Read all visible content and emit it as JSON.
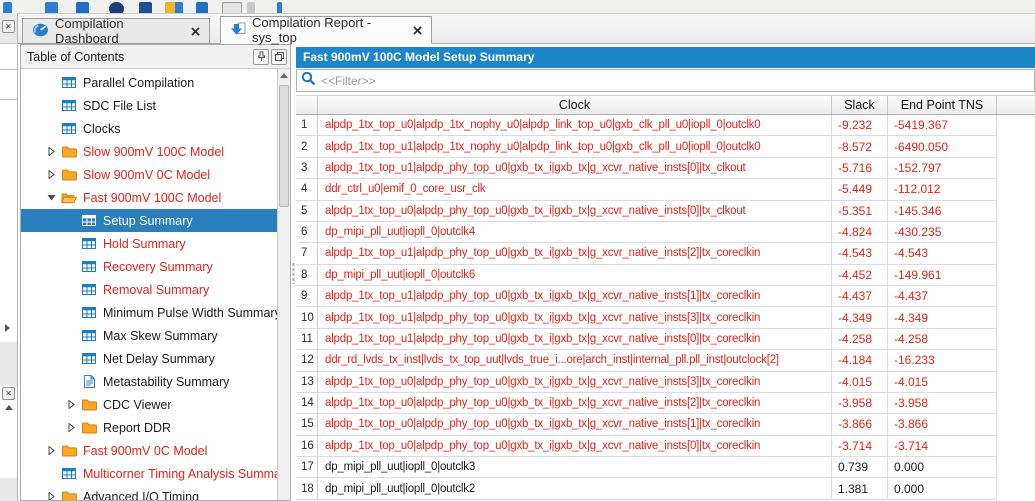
{
  "tabs": [
    {
      "label": "Compilation Dashboard",
      "icon": "gauge-icon",
      "active": false
    },
    {
      "label": "Compilation Report - sys_top",
      "icon": "report-icon",
      "active": true
    }
  ],
  "toc": {
    "title": "Table of Contents",
    "items": [
      {
        "label": "Parallel Compilation",
        "icon": "table",
        "level": 1
      },
      {
        "label": "SDC File List",
        "icon": "table",
        "level": 1
      },
      {
        "label": "Clocks",
        "icon": "table",
        "level": 1
      },
      {
        "label": "Slow 900mV 100C Model",
        "icon": "folder",
        "level": 1,
        "arrow": "collapsed",
        "red": true
      },
      {
        "label": "Slow 900mV 0C Model",
        "icon": "folder",
        "level": 1,
        "arrow": "collapsed",
        "red": true
      },
      {
        "label": "Fast 900mV 100C Model",
        "icon": "folder-open",
        "level": 1,
        "arrow": "expanded",
        "red": true
      },
      {
        "label": "Setup Summary",
        "icon": "table",
        "level": 2,
        "selected": true
      },
      {
        "label": "Hold Summary",
        "icon": "table",
        "level": 2,
        "red": true
      },
      {
        "label": "Recovery Summary",
        "icon": "table",
        "level": 2,
        "red": true
      },
      {
        "label": "Removal Summary",
        "icon": "table",
        "level": 2,
        "red": true
      },
      {
        "label": "Minimum Pulse Width Summary",
        "icon": "table",
        "level": 2
      },
      {
        "label": "Max Skew Summary",
        "icon": "table",
        "level": 2
      },
      {
        "label": "Net Delay Summary",
        "icon": "table",
        "level": 2
      },
      {
        "label": "Metastability Summary",
        "icon": "doc",
        "level": 2
      },
      {
        "label": "CDC Viewer",
        "icon": "folder",
        "level": 2,
        "arrow": "collapsed"
      },
      {
        "label": "Report DDR",
        "icon": "folder",
        "level": 2,
        "arrow": "collapsed"
      },
      {
        "label": "Fast 900mV 0C Model",
        "icon": "folder",
        "level": 1,
        "arrow": "collapsed",
        "red": true
      },
      {
        "label": "Multicorner Timing Analysis Summary",
        "icon": "table",
        "level": 1,
        "red": true
      },
      {
        "label": "Advanced I/O Timing",
        "icon": "folder",
        "level": 1,
        "arrow": "collapsed"
      }
    ]
  },
  "report": {
    "title": "Fast 900mV 100C Model Setup Summary",
    "filter_placeholder": "<<Filter>>",
    "columns": {
      "clock": "Clock",
      "slack": "Slack",
      "tns": "End Point TNS"
    },
    "rows": [
      {
        "num": 1,
        "clock": "alpdp_1tx_top_u0|alpdp_1tx_nophy_u0|alpdp_link_top_u0|gxb_clk_pll_u0|iopll_0|outclk0",
        "slack": "-9.232",
        "tns": "-5419.367",
        "violated": true
      },
      {
        "num": 2,
        "clock": "alpdp_1tx_top_u1|alpdp_1tx_nophy_u0|alpdp_link_top_u0|gxb_clk_pll_u0|iopll_0|outclk0",
        "slack": "-8.572",
        "tns": "-6490.050",
        "violated": true
      },
      {
        "num": 3,
        "clock": "alpdp_1tx_top_u1|alpdp_phy_top_u0|gxb_tx_i|gxb_tx|g_xcvr_native_insts[0]|tx_clkout",
        "slack": "-5.716",
        "tns": "-152.797",
        "violated": true
      },
      {
        "num": 4,
        "clock": "ddr_ctrl_u0|emif_0_core_usr_clk",
        "slack": "-5.449",
        "tns": "-112.012",
        "violated": true
      },
      {
        "num": 5,
        "clock": "alpdp_1tx_top_u0|alpdp_phy_top_u0|gxb_tx_i|gxb_tx|g_xcvr_native_insts[0]|tx_clkout",
        "slack": "-5.351",
        "tns": "-145.346",
        "violated": true
      },
      {
        "num": 6,
        "clock": "dp_mipi_pll_uut|iopll_0|outclk4",
        "slack": "-4.824",
        "tns": "-430.235",
        "violated": true
      },
      {
        "num": 7,
        "clock": "alpdp_1tx_top_u1|alpdp_phy_top_u0|gxb_tx_i|gxb_tx|g_xcvr_native_insts[2]|tx_coreclkin",
        "slack": "-4.543",
        "tns": "-4.543",
        "violated": true
      },
      {
        "num": 8,
        "clock": "dp_mipi_pll_uut|iopll_0|outclk6",
        "slack": "-4.452",
        "tns": "-149.961",
        "violated": true
      },
      {
        "num": 9,
        "clock": "alpdp_1tx_top_u1|alpdp_phy_top_u0|gxb_tx_i|gxb_tx|g_xcvr_native_insts[1]|tx_coreclkin",
        "slack": "-4.437",
        "tns": "-4.437",
        "violated": true
      },
      {
        "num": 10,
        "clock": "alpdp_1tx_top_u1|alpdp_phy_top_u0|gxb_tx_i|gxb_tx|g_xcvr_native_insts[3]|tx_coreclkin",
        "slack": "-4.349",
        "tns": "-4.349",
        "violated": true
      },
      {
        "num": 11,
        "clock": "alpdp_1tx_top_u1|alpdp_phy_top_u0|gxb_tx_i|gxb_tx|g_xcvr_native_insts[0]|tx_coreclkin",
        "slack": "-4.258",
        "tns": "-4.258",
        "violated": true
      },
      {
        "num": 12,
        "clock": "ddr_rd_lvds_tx_inst|lvds_tx_top_uut|lvds_true_i...ore|arch_inst|internal_pll.pll_inst|outclock[2]",
        "slack": "-4.184",
        "tns": "-16.233",
        "violated": true
      },
      {
        "num": 13,
        "clock": "alpdp_1tx_top_u0|alpdp_phy_top_u0|gxb_tx_i|gxb_tx|g_xcvr_native_insts[3]|tx_coreclkin",
        "slack": "-4.015",
        "tns": "-4.015",
        "violated": true
      },
      {
        "num": 14,
        "clock": "alpdp_1tx_top_u0|alpdp_phy_top_u0|gxb_tx_i|gxb_tx|g_xcvr_native_insts[2]|tx_coreclkin",
        "slack": "-3.958",
        "tns": "-3.958",
        "violated": true
      },
      {
        "num": 15,
        "clock": "alpdp_1tx_top_u0|alpdp_phy_top_u0|gxb_tx_i|gxb_tx|g_xcvr_native_insts[1]|tx_coreclkin",
        "slack": "-3.866",
        "tns": "-3.866",
        "violated": true
      },
      {
        "num": 16,
        "clock": "alpdp_1tx_top_u0|alpdp_phy_top_u0|gxb_tx_i|gxb_tx|g_xcvr_native_insts[0]|tx_coreclkin",
        "slack": "-3.714",
        "tns": "-3.714",
        "violated": true
      },
      {
        "num": 17,
        "clock": "dp_mipi_pll_uut|iopll_0|outclk3",
        "slack": "0.739",
        "tns": "0.000",
        "violated": false
      },
      {
        "num": 18,
        "clock": "dp_mipi_pll_uut|iopll_0|outclk2",
        "slack": "1.381",
        "tns": "0.000",
        "violated": false
      }
    ]
  },
  "colors": {
    "title_blue": "#1d86c8",
    "selection_blue": "#2a7fbc",
    "violation_red": "#e2241b",
    "text_black": "#1c1c1c",
    "folder_orange": "#f9a825"
  }
}
